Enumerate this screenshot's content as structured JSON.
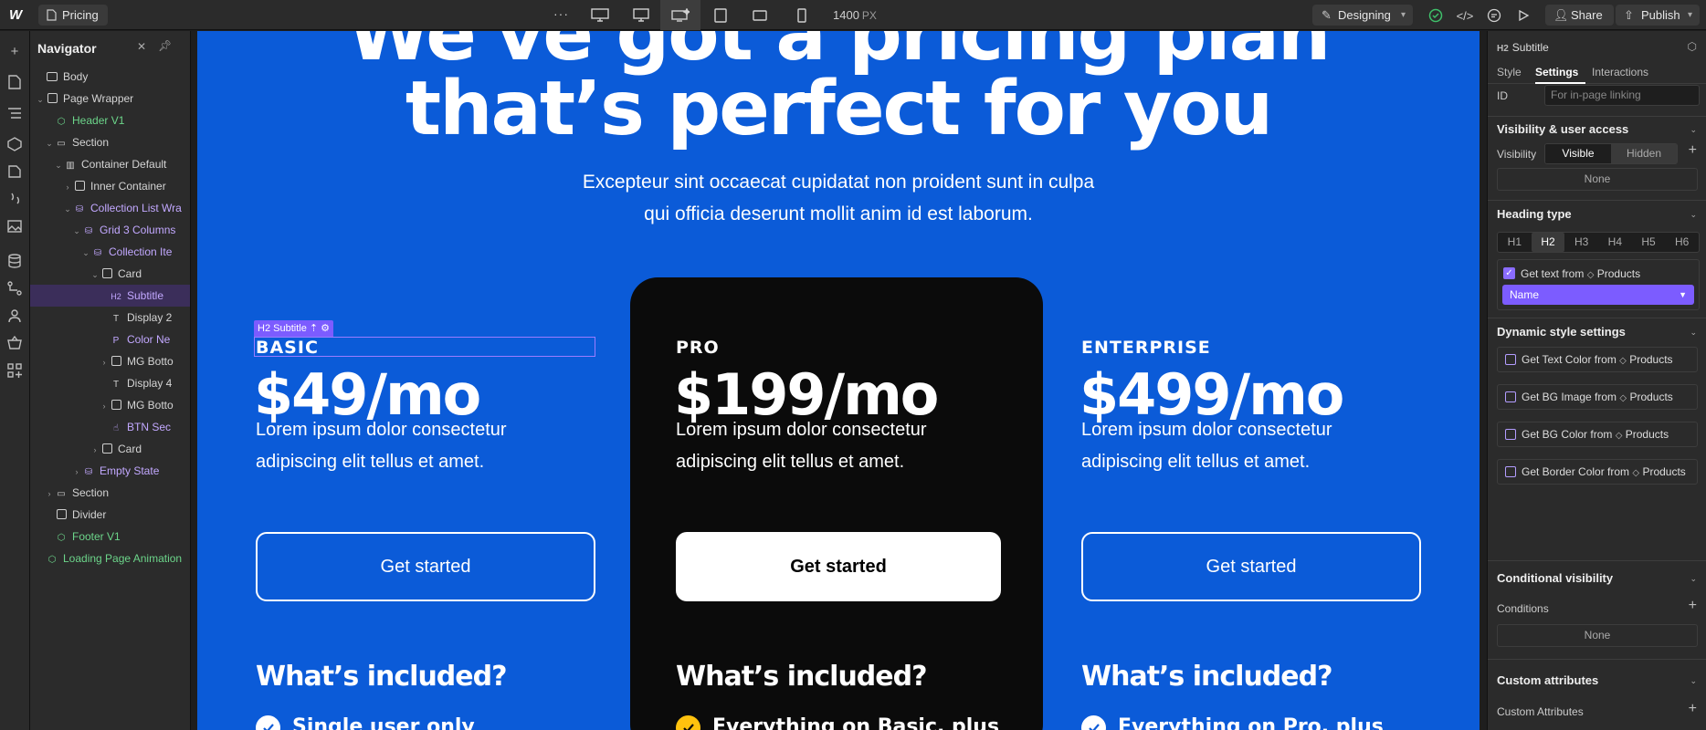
{
  "topbar": {
    "logo": "W",
    "page_name": "Pricing",
    "more": "···",
    "width_value": "1400",
    "width_unit": "PX",
    "mode_label": "Designing",
    "share_label": "Share",
    "publish_label": "Publish"
  },
  "navigator": {
    "title": "Navigator",
    "items": [
      {
        "label": "Body"
      },
      {
        "label": "Page Wrapper"
      },
      {
        "label": "Header V1"
      },
      {
        "label": "Section"
      },
      {
        "label": "Container Default"
      },
      {
        "label": "Inner Container"
      },
      {
        "label": "Collection List Wra"
      },
      {
        "label": "Grid 3 Columns"
      },
      {
        "label": "Collection Ite"
      },
      {
        "label": "Card"
      },
      {
        "label": "Subtitle",
        "tag": "H2"
      },
      {
        "label": "Display 2"
      },
      {
        "label": "Color Ne"
      },
      {
        "label": "MG Botto"
      },
      {
        "label": "Display 4"
      },
      {
        "label": "MG Botto"
      },
      {
        "label": "BTN Sec"
      },
      {
        "label": "Card"
      },
      {
        "label": "Empty State"
      },
      {
        "label": "Section"
      },
      {
        "label": "Divider"
      },
      {
        "label": "Footer V1"
      },
      {
        "label": "Loading Page Animation"
      }
    ]
  },
  "canvas": {
    "headline_line1": "We've got a pricing plan",
    "headline_line2": "that’s perfect for you",
    "subtitle_line1": "Excepteur sint occaecat cupidatat non proident sunt in culpa",
    "subtitle_line2": "qui officia deserunt mollit anim id est laborum.",
    "selection_tag": "H2 Subtitle",
    "plans": [
      {
        "name": "BASIC",
        "price": "$49/mo",
        "desc1": "Lorem ipsum dolor consectetur",
        "desc2": "adipiscing elit tellus et amet.",
        "button": "Get started",
        "included": "What’s included?",
        "feature": "Single user only"
      },
      {
        "name": "PRO",
        "price": "$199/mo",
        "desc1": "Lorem ipsum dolor consectetur",
        "desc2": "adipiscing elit tellus et amet.",
        "button": "Get started",
        "included": "What’s included?",
        "feature": "Everything on Basic, plus"
      },
      {
        "name": "ENTERPRISE",
        "price": "$499/mo",
        "desc1": "Lorem ipsum dolor consectetur",
        "desc2": "adipiscing elit tellus et amet.",
        "button": "Get started",
        "included": "What’s included?",
        "feature": "Everything on Pro, plus"
      }
    ]
  },
  "settings": {
    "element_tag": "H2",
    "element_name": "Subtitle",
    "tabs": [
      "Style",
      "Settings",
      "Interactions"
    ],
    "id_label": "ID",
    "id_placeholder": "For in-page linking",
    "visibility_title": "Visibility & user access",
    "visibility_label": "Visibility",
    "visible": "Visible",
    "hidden": "Hidden",
    "none1": "None",
    "heading_type_title": "Heading type",
    "heading_types": [
      "H1",
      "H2",
      "H3",
      "H4",
      "H5",
      "H6"
    ],
    "get_text_label": "Get text from",
    "products": "Products",
    "name_select": "Name",
    "dynamic_title": "Dynamic style settings",
    "dynamic_items": [
      "Get Text Color from",
      "Get BG Image from",
      "Get BG Color from",
      "Get Border Color from"
    ],
    "conditional_title": "Conditional visibility",
    "conditions_label": "Conditions",
    "none2": "None",
    "custom_attr_title": "Custom attributes",
    "custom_attr_label": "Custom Attributes"
  },
  "colors": {
    "canvas_bg": "#0b5bd8",
    "dark_card": "#0b0b0b",
    "accent": "#7c5cff",
    "check_yellow": "#ffc20e"
  }
}
